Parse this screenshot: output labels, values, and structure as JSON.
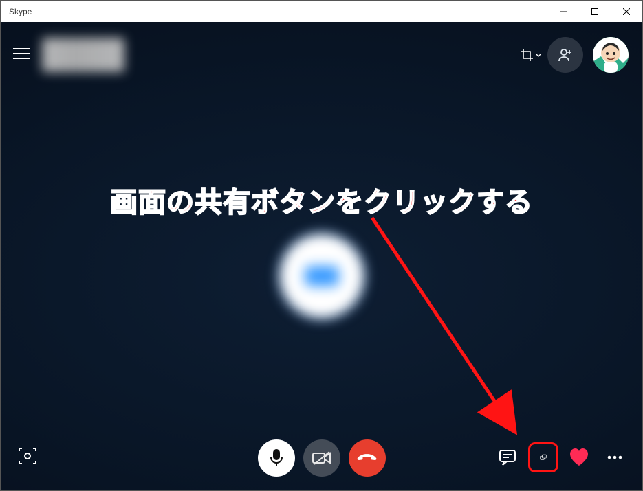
{
  "window": {
    "title": "Skype"
  },
  "annotation": {
    "text": "画面の共有ボタンをクリックする"
  },
  "icons": {
    "menu": "menu-icon",
    "crop": "crop-icon",
    "add_person": "add-person-icon",
    "snapshot": "snapshot-icon",
    "mic": "microphone-icon",
    "camera_off": "camera-off-icon",
    "hangup": "hangup-icon",
    "chat": "chat-icon",
    "share": "share-screen-icon",
    "heart": "heart-icon",
    "more": "more-icon"
  },
  "colors": {
    "accent_red": "#ff1414",
    "hangup_red": "#e73e2e",
    "heart_red": "#ff2b55",
    "bg_dark": "#091627"
  }
}
